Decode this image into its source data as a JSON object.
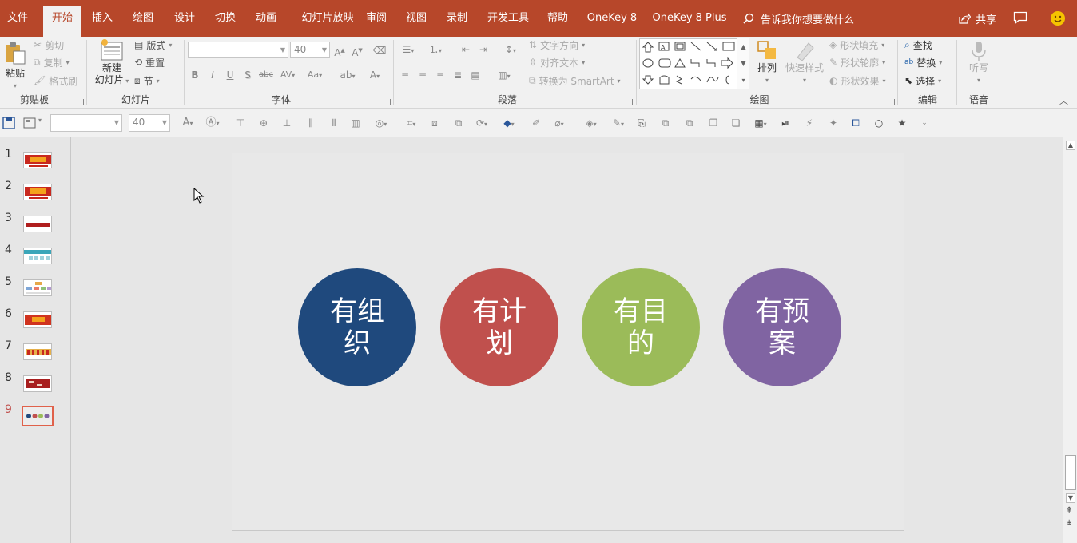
{
  "tabs": [
    "文件",
    "开始",
    "插入",
    "绘图",
    "设计",
    "切换",
    "动画",
    "幻灯片放映",
    "审阅",
    "视图",
    "录制",
    "开发工具",
    "帮助",
    "OneKey 8",
    "OneKey 8 Plus"
  ],
  "active_tab": "开始",
  "tell_me": "告诉我你想要做什么",
  "share": "共享",
  "colors": {
    "accent": "#b7472a",
    "circle1": "#1f497d",
    "circle2": "#c0504d",
    "circle3": "#9bbb59",
    "circle4": "#8064a2",
    "selected_slide": "#e0614a"
  },
  "ribbon": {
    "clipboard": {
      "label": "剪贴板",
      "paste": "粘贴",
      "cut": "剪切",
      "copy": "复制",
      "format_painter": "格式刷"
    },
    "slides": {
      "label": "幻灯片",
      "new_slide_line1": "新建",
      "new_slide_line2": "幻灯片",
      "layout": "版式",
      "reset": "重置",
      "section": "节"
    },
    "font": {
      "label": "字体",
      "font_name": "",
      "font_size": "40",
      "bold": "B",
      "italic": "I",
      "underline": "U",
      "shadow": "S",
      "strike": "abc",
      "spacing": "AV",
      "case": "Aa"
    },
    "paragraph": {
      "label": "段落",
      "text_direction": "文字方向",
      "align_text": "对齐文本",
      "smartart": "转换为 SmartArt"
    },
    "drawing": {
      "label": "绘图",
      "arrange": "排列",
      "quick_styles": "快速样式",
      "shape_fill": "形状填充",
      "shape_outline": "形状轮廓",
      "shape_effects": "形状效果"
    },
    "editing": {
      "label": "编辑",
      "find": "查找",
      "replace": "替换",
      "select": "选择"
    },
    "voice": {
      "label": "语音",
      "dictate": "听写"
    }
  },
  "qat": {
    "font_name": "",
    "font_size": "40"
  },
  "slides": [
    {
      "number": "1"
    },
    {
      "number": "2"
    },
    {
      "number": "3"
    },
    {
      "number": "4"
    },
    {
      "number": "5"
    },
    {
      "number": "6"
    },
    {
      "number": "7"
    },
    {
      "number": "8"
    },
    {
      "number": "9",
      "selected": true
    }
  ],
  "current_slide": {
    "circles": [
      {
        "line1": "有组",
        "line2": "织",
        "color": "#1f497d"
      },
      {
        "line1": "有计",
        "line2": "划",
        "color": "#c0504d"
      },
      {
        "line1": "有目",
        "line2": "的",
        "color": "#9bbb59"
      },
      {
        "line1": "有预",
        "line2": "案",
        "color": "#8064a2"
      }
    ]
  }
}
